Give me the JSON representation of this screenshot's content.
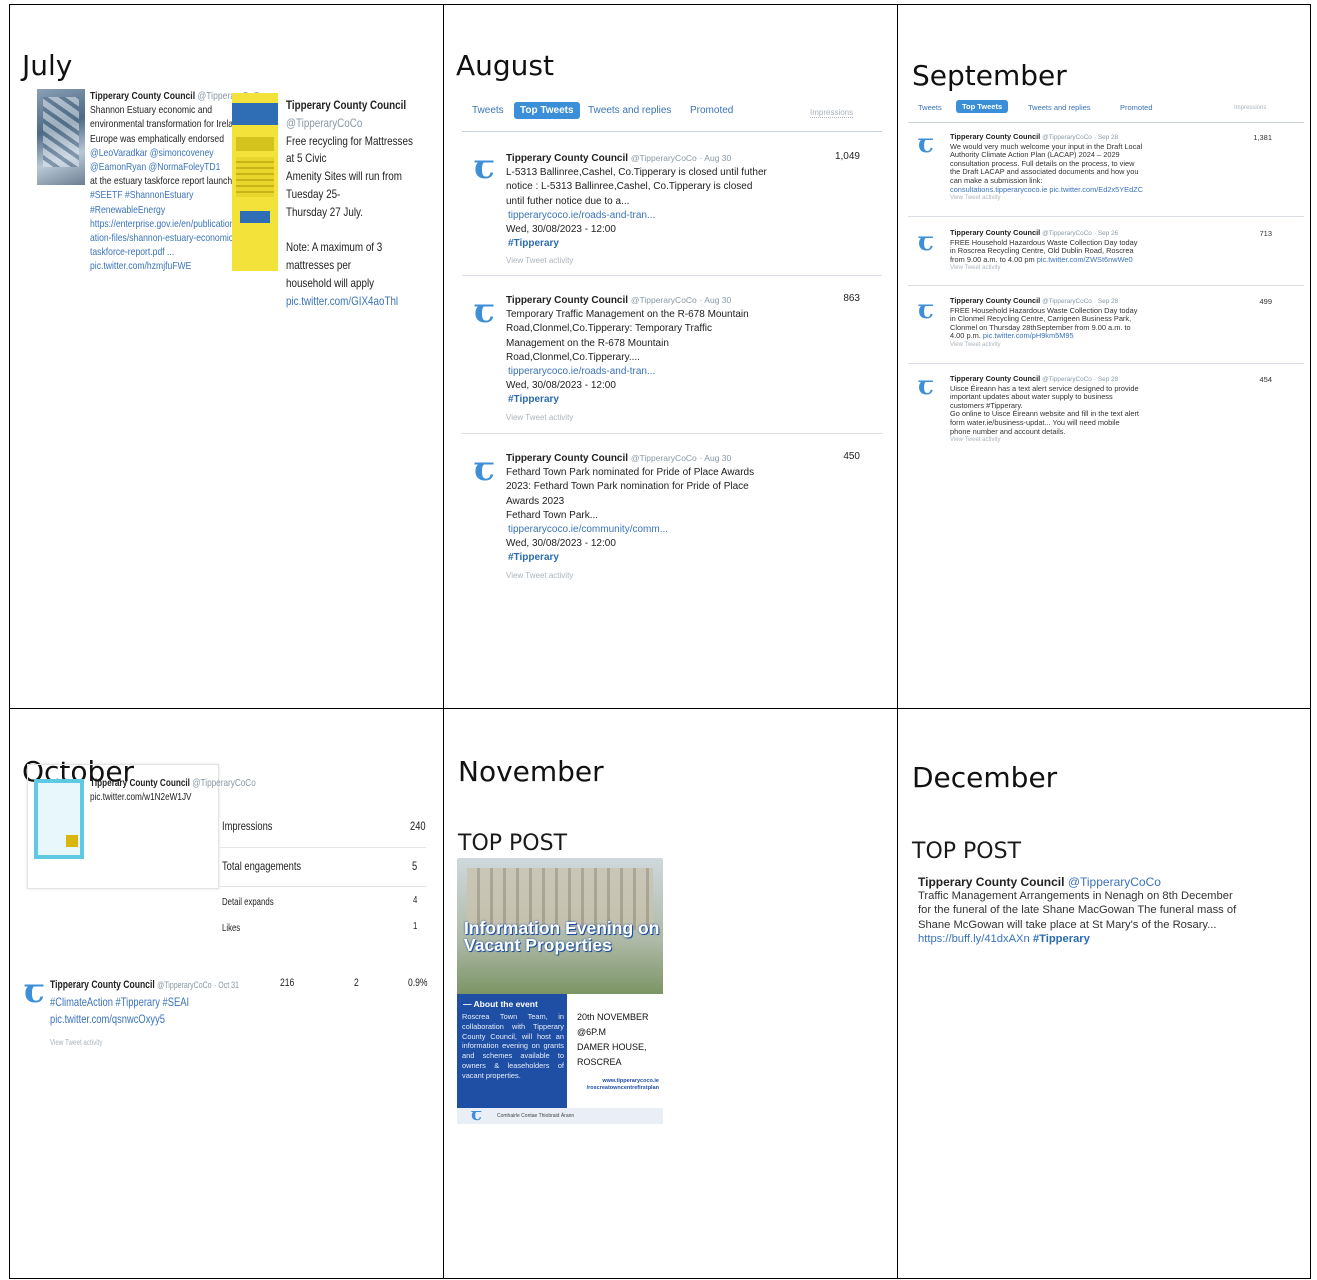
{
  "months": {
    "july": "July",
    "august": "August",
    "september": "September",
    "october": "October",
    "november": "November",
    "december": "December"
  },
  "account": {
    "name": "Tipperary County Council",
    "handle": "@TipperaryCoCo"
  },
  "july": {
    "tweet1_lines": [
      "Shannon Estuary economic and",
      "environmental transformation for Ireland &",
      "Europe was emphatically endorsed",
      "@LeoVaradkar @simoncoveney",
      "@EamonRyan @NormaFoleyTD1",
      "at the estuary taskforce report launch.",
      "#SEETF #ShannonEstuary",
      "#RenewableEnergy",
      "https://enterprise.gov.ie/en/publications/public",
      "ation-files/shannon-estuary-economic-",
      "taskforce-report.pdf ...",
      "pic.twitter.com/hzmjfuFWE"
    ],
    "tweet2_lines": [
      "Free recycling for Mattresses at 5 Civic",
      "Amenity Sites will run from Tuesday 25-",
      "Thursday 27 July.",
      "",
      "Note: A maximum of 3 mattresses per",
      "household will apply",
      "pic.twitter.com/GIX4aoThl"
    ]
  },
  "august": {
    "tabs": [
      "Tweets",
      "Top Tweets",
      "Tweets and replies",
      "Promoted"
    ],
    "impressions_label": "Impressions",
    "view_activity": "View Tweet activity",
    "tweets": [
      {
        "meta": "· Aug 30",
        "lines": [
          "L-5313 Ballinree,Cashel, Co.Tipperary is closed until futher",
          "notice : L-5313 Ballinree,Cashel, Co.Tipperary is closed",
          "until futher notice  due to a..."
        ],
        "link": "tipperarycoco.ie/roads-and-tran...",
        "date": "Wed, 30/08/2023 - 12:00",
        "tag": "#Tipperary",
        "impressions": "1,049"
      },
      {
        "meta": "· Aug 30",
        "lines": [
          "Temporary Traffic Management on the R-678 Mountain",
          "Road,Clonmel,Co.Tipperary: Temporary Traffic",
          "Management on the R-678 Mountain",
          "Road,Clonmel,Co.Tipperary...."
        ],
        "link": "tipperarycoco.ie/roads-and-tran...",
        "date": "Wed, 30/08/2023 - 12:00",
        "tag": "#Tipperary",
        "impressions": "863"
      },
      {
        "meta": "· Aug 30",
        "lines": [
          "Fethard Town Park nominated for Pride of Place Awards",
          "2023: Fethard Town Park nomination for Pride of Place",
          "Awards 2023",
          "Fethard Town Park..."
        ],
        "link": "tipperarycoco.ie/community/comm...",
        "date": "Wed, 30/08/2023 - 12:00",
        "tag": "#Tipperary",
        "impressions": "450"
      }
    ]
  },
  "september": {
    "tabs": [
      "Tweets",
      "Top Tweets",
      "Tweets and replies",
      "Promoted"
    ],
    "impressions_label": "Impressions",
    "view_activity": "View Tweet activity",
    "tweets": [
      {
        "meta": "· Sep 28",
        "lines": [
          "We would very much welcome your input in the Draft Local",
          "Authority Climate Action Plan (LACAP) 2024 – 2029",
          "consultation process.  Full details on the process, to view",
          "the Draft LACAP and associated documents and how you",
          "can make a submission link:"
        ],
        "link": "consultations.tipperarycoco.ie pic.twitter.com/Ed2x5YEdZC",
        "impressions": "1,381"
      },
      {
        "meta": "· Sep 26",
        "lines": [
          "FREE Household Hazardous Waste Collection Day today",
          "in Roscrea Recycling Centre, Old Dublin Road, Roscrea",
          "from 9.00 a.m. to 4.00 pm"
        ],
        "link": "pic.twitter.com/ZWSt6nwWe0",
        "impressions": "713"
      },
      {
        "meta": "· Sep 28",
        "lines": [
          "FREE Household Hazardous Waste Collection Day today",
          "in Clonmel Recycling Centre, Carrigeen Business Park,",
          "Clonmel  on Thursday 28thSeptember from 9.00 a.m. to",
          "4.00 p.m."
        ],
        "link": "pic.twitter.com/pH9km5M95",
        "impressions": "499"
      },
      {
        "meta": "· Sep 28",
        "lines": [
          "Uisce Éireann has a  text alert service designed to provide",
          "important updates about water supply to business",
          "customers #Tipperary.",
          "Go online to Uisce Éireann  website and fill in the text alert",
          "form water.ie/business-updat...  You will need mobile",
          "phone number and account details."
        ],
        "link": "",
        "impressions": "454"
      }
    ]
  },
  "october": {
    "card_link": "pic.twitter.com/w1N2eW1JV",
    "stats": [
      {
        "label": "Impressions",
        "value": "240"
      },
      {
        "label": "Total engagements",
        "value": "5"
      },
      {
        "label": "Detail expands",
        "value": "4"
      },
      {
        "label": "Likes",
        "value": "1"
      }
    ],
    "tweet": {
      "meta": "· Oct 31",
      "impressions": "216",
      "engagements": "2",
      "rate": "0.9%",
      "tags": "#ClimateAction #Tipperary #SEAI",
      "link": "pic.twitter.com/qsnwcOxyy5",
      "view_activity": "View Tweet activity"
    }
  },
  "november": {
    "top_post": "TOP POST",
    "poster": {
      "title": "Information Evening on Vacant Properties",
      "about": "— About the event",
      "body": "Roscrea Town Team, in collaboration with Tipperary County Council, will host an information evening on grants and schemes available to owners & leaseholders of vacant properties.",
      "when": [
        "20th NOVEMBER",
        "@6P.M",
        "DAMER HOUSE,",
        "ROSCREA"
      ],
      "url": "www.tipperarycoco.ie /roscreatowncentrefirstplan",
      "footer": "Comhairle Contae Thiobraid Árann"
    }
  },
  "december": {
    "top_post": "TOP POST",
    "lines": [
      "Traffic Management Arrangements in Nenagh on 8th December",
      "for the funeral of the late Shane MacGowan  The funeral mass of",
      "Shane McGowan will take place at St Mary's of the Rosary..."
    ],
    "link": "https://buff.ly/41dxAXn",
    "tag": "#Tipperary"
  },
  "colors": {
    "link": "#3b73b9",
    "tab_active": "#3b8fd9",
    "logo": "#3d8fd8"
  }
}
